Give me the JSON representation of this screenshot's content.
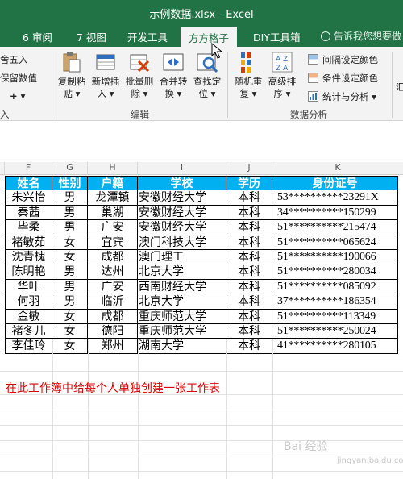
{
  "window": {
    "title": "示例数据.xlsx - Excel"
  },
  "tabs": [
    "6 审阅",
    "7 视图",
    "开发工具",
    "方方格子",
    "DIY工具箱"
  ],
  "active_tab": "方方格子",
  "tell_me": "告诉我您想要做",
  "ribbon": {
    "left_partial": [
      "舍五入",
      "保留数值",
      "入"
    ],
    "buttons": [
      {
        "label1": "复制粘",
        "label2": "贴 ▾"
      },
      {
        "label1": "新增插",
        "label2": "入 ▾"
      },
      {
        "label1": "批量删",
        "label2": "除 ▾"
      },
      {
        "label1": "合并转",
        "label2": "换 ▾"
      },
      {
        "label1": "查找定",
        "label2": "位 ▾"
      },
      {
        "label1": "随机重",
        "label2": "复 ▾"
      },
      {
        "label1": "高级排",
        "label2": "序 ▾"
      }
    ],
    "group_edit": "编辑",
    "group_analysis": "数据分析",
    "small_buttons": [
      "间隔设定颜色",
      "条件设定颜色",
      "统计与分析 ▾"
    ],
    "right_partial": "汇"
  },
  "columns": [
    "F",
    "G",
    "H",
    "I",
    "J",
    "K"
  ],
  "table": {
    "headers": [
      "姓名",
      "性别",
      "户籍",
      "学校",
      "学历",
      "身份证号"
    ],
    "rows": [
      [
        "朱兴怡",
        "男",
        "龙潭镇",
        "安徽财经大学",
        "本科",
        "53**********23291X"
      ],
      [
        "秦茜",
        "男",
        "巢湖",
        "安徽财经大学",
        "本科",
        "34**********150299"
      ],
      [
        "毕柔",
        "男",
        "广安",
        "安徽财经大学",
        "本科",
        "51**********215474"
      ],
      [
        "褚敏茹",
        "女",
        "宜宾",
        "澳门科技大学",
        "本科",
        "51**********065624"
      ],
      [
        "沈青槐",
        "女",
        "成都",
        "澳门理工",
        "本科",
        "51**********190066"
      ],
      [
        "陈明艳",
        "男",
        "达州",
        "北京大学",
        "本科",
        "51**********280034"
      ],
      [
        "华叶",
        "男",
        "广安",
        "西南财经大学",
        "本科",
        "51**********085092"
      ],
      [
        "何羽",
        "男",
        "临沂",
        "北京大学",
        "本科",
        "37**********186354"
      ],
      [
        "金敏",
        "女",
        "成都",
        "重庆师范大学",
        "本科",
        "51**********113349"
      ],
      [
        "褚冬儿",
        "女",
        "德阳",
        "重庆师范大学",
        "本科",
        "51**********250024"
      ],
      [
        "李佳玲",
        "女",
        "郑州",
        "湖南大学",
        "本科",
        "41**********280105"
      ]
    ]
  },
  "note": "在此工作簿中给每个人单独创建一张工作表",
  "watermark": "Bai 经验",
  "watermark_sub": "jingyan.baidu.com",
  "colors": {
    "accent": "#217346",
    "header_fill": "#00b0f0",
    "note": "#e00000"
  }
}
